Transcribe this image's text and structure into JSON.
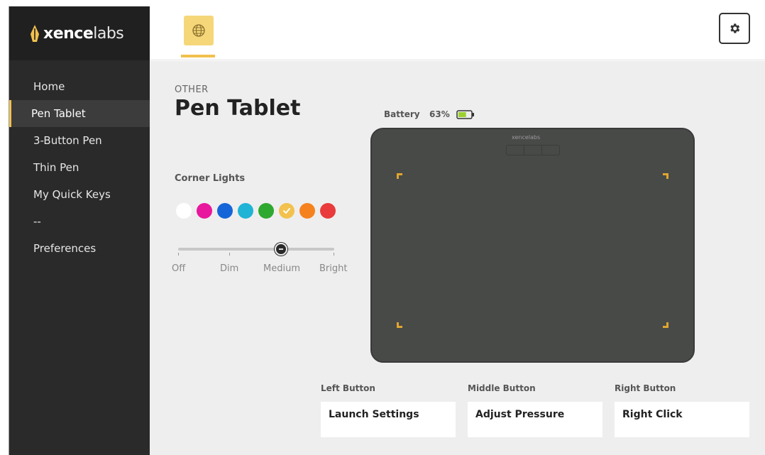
{
  "brand": {
    "name_bold": "xence",
    "name_light": "labs"
  },
  "sidebar": {
    "items": [
      {
        "label": "Home",
        "active": false
      },
      {
        "label": "Pen Tablet",
        "active": true
      },
      {
        "label": "3-Button Pen",
        "active": false
      },
      {
        "label": "Thin Pen",
        "active": false
      },
      {
        "label": "My Quick Keys",
        "active": false
      },
      {
        "label": "--",
        "active": false
      },
      {
        "label": "Preferences",
        "active": false
      }
    ]
  },
  "topbar": {
    "device_icon": "globe-icon",
    "settings_icon": "gear-icon"
  },
  "page": {
    "eyebrow": "OTHER",
    "title": "Pen Tablet"
  },
  "corner_lights": {
    "label": "Corner Lights",
    "colors": [
      "#ffffff",
      "#e8179d",
      "#1565d8",
      "#1fb3d6",
      "#2fa82f",
      "#f2c14e",
      "#f5821f",
      "#e93b3b"
    ],
    "selected_index": 5,
    "brightness": {
      "levels": [
        "Off",
        "Dim",
        "Medium",
        "Bright"
      ],
      "selected": "Medium"
    }
  },
  "battery": {
    "label": "Battery",
    "value": "63%",
    "level": 0.63,
    "color": "#9bd12f"
  },
  "tablet": {
    "brand": "xencelabs",
    "corner_light_color": "#e0a52f",
    "body_color": "#484a48"
  },
  "buttons": {
    "left": {
      "label": "Left Button",
      "value": "Launch Settings"
    },
    "middle": {
      "label": "Middle Button",
      "value": "Adjust Pressure"
    },
    "right": {
      "label": "Right Button",
      "value": "Right Click"
    }
  }
}
